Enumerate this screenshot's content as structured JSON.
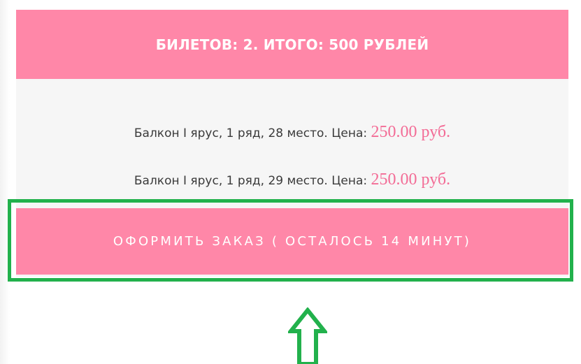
{
  "header": {
    "title": "БИЛЕТОВ: 2. ИТОГО: 500 РУБЛЕЙ"
  },
  "tickets": [
    {
      "description": "Балкон I ярус, 1 ряд, 28 место. Цена:",
      "price": "250.00 руб."
    },
    {
      "description": "Балкон I ярус, 1 ряд, 29 место. Цена:",
      "price": "250.00 руб."
    }
  ],
  "order": {
    "button_label": "ОФОРМИТЬ ЗАКАЗ ( ОСТАЛОСЬ 14 МИНУТ)"
  },
  "colors": {
    "accent_pink": "#ff87a8",
    "price_pink": "#f36c96",
    "highlight_green": "#22b14c",
    "panel_gray": "#f6f6f6"
  },
  "icons": {
    "highlight_arrow": "up-arrow-icon"
  }
}
